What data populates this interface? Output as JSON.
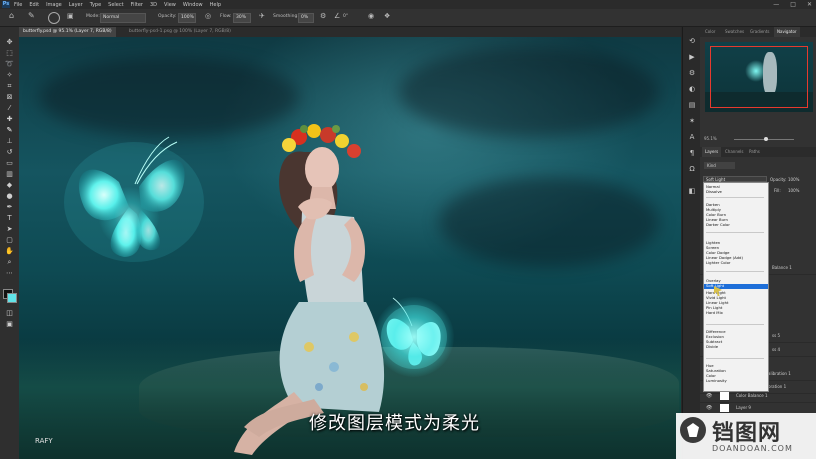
{
  "menu": {
    "logo": "Ps",
    "items": [
      "File",
      "Edit",
      "Image",
      "Layer",
      "Type",
      "Select",
      "Filter",
      "3D",
      "View",
      "Window",
      "Help"
    ],
    "window_controls": [
      "—",
      "□",
      "✕"
    ]
  },
  "options_bar": {
    "mode_label": "Mode:",
    "mode_value": "Normal",
    "opacity_label": "Opacity:",
    "opacity_value": "100%",
    "flow_label": "Flow:",
    "flow_value": "30%",
    "smoothing_label": "Smoothing:",
    "smoothing_value": "0%",
    "angle_value": "0°"
  },
  "document_tabs": [
    {
      "label": "butterfly.psd @ 95.1% (Layer 7, RGB/8)",
      "active": true
    },
    {
      "label": "butterfly-psd-1.psg @ 100% (Layer 7, RGB/8)",
      "active": false
    }
  ],
  "canvas": {
    "subtitle": "修改图层模式为柔光",
    "watermark_small": "RAFY"
  },
  "panels": {
    "top_tabs": [
      "Color",
      "Swatches",
      "Gradients",
      "Navigator"
    ],
    "zoom": "95.1%",
    "layer_tabs": [
      "Layers",
      "Channels",
      "Paths"
    ],
    "kind_label": "Kind",
    "blend_current": "Soft Light",
    "opacity_label": "Opacity:",
    "opacity_value": "100%",
    "fill_label": "Fill:",
    "fill_value": "100%",
    "layer_names": [
      "Color Balance 1",
      "Layer 9",
      "Layer 6",
      "Color Balance 1",
      "Layer 8"
    ],
    "side_labels": [
      "Balance 1",
      "ss 5",
      "ss 4",
      "alibration 1",
      "bration 1"
    ]
  },
  "blend_modes": [
    [
      "Normal",
      "Dissolve"
    ],
    [
      "Darken",
      "Multiply",
      "Color Burn",
      "Linear Burn",
      "Darker Color"
    ],
    [
      "Lighten",
      "Screen",
      "Color Dodge",
      "Linear Dodge (Add)",
      "Lighter Color"
    ],
    [
      "Overlay",
      "Soft Light",
      "Hard Light",
      "Vivid Light",
      "Linear Light",
      "Pin Light",
      "Hard Mix"
    ],
    [
      "Difference",
      "Exclusion",
      "Subtract",
      "Divide"
    ],
    [
      "Hue",
      "Saturation",
      "Color",
      "Luminosity"
    ]
  ],
  "blend_selected": "Soft Light",
  "watermark": {
    "cn": "铛图网",
    "en": "DOANDOAN.COM"
  }
}
